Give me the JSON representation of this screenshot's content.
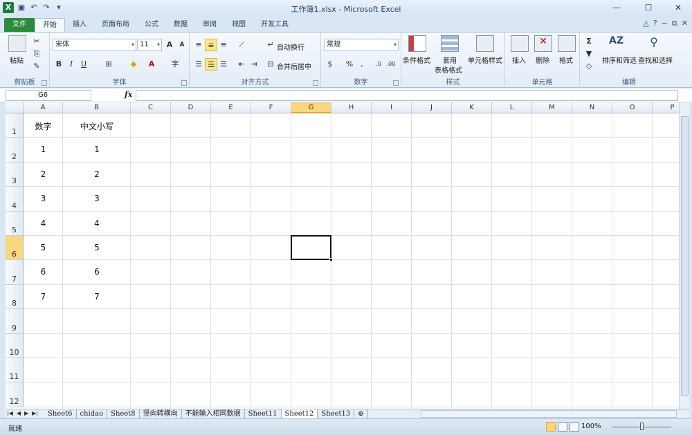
{
  "window": {
    "title": "工作簿1.xlsx - Microsoft Excel",
    "controls": [
      "—",
      "☐",
      "✕"
    ]
  },
  "ribbon_tabs": [
    "文件",
    "开始",
    "插入",
    "页面布局",
    "公式",
    "数据",
    "审阅",
    "视图",
    "开发工具"
  ],
  "active_tab": "开始",
  "groups": {
    "clipboard": {
      "label": "剪贴板",
      "paste": "粘贴"
    },
    "font": {
      "label": "字体",
      "font_name": "宋体",
      "font_size": "11",
      "bold": "B",
      "italic": "I",
      "underline": "U"
    },
    "alignment": {
      "label": "对齐方式",
      "wrap_text": "自动换行",
      "merge_center": "合并后居中"
    },
    "number": {
      "label": "数字",
      "format": "常规",
      "percent": "%",
      "comma": ","
    },
    "styles": {
      "label": "样式",
      "conditional": "条件格式",
      "table": "套用",
      "table2": "表格格式",
      "cell_styles": "单元格样式"
    },
    "cells": {
      "label": "单元格",
      "insert": "插入",
      "delete": "删除",
      "format": "格式"
    },
    "editing": {
      "label": "编辑",
      "sort": "排序和筛选",
      "find": "查找和选择"
    }
  },
  "formula_bar": {
    "name_box": "G6",
    "fx": "fx",
    "formula": ""
  },
  "columns": [
    "A",
    "B",
    "C",
    "D",
    "E",
    "F",
    "G",
    "H",
    "I",
    "J",
    "K",
    "L",
    "M",
    "N",
    "O",
    "P"
  ],
  "selected_column": "G",
  "rows": [
    "1",
    "2",
    "3",
    "4",
    "5",
    "6",
    "7",
    "8",
    "9",
    "10",
    "11",
    "12"
  ],
  "selected_row": "6",
  "cells": {
    "A1": "数字",
    "B1": "中文小写",
    "A2": "1",
    "B2": "1",
    "A3": "2",
    "B3": "2",
    "A4": "3",
    "B4": "3",
    "A5": "4",
    "B5": "4",
    "A6": "5",
    "B6": "5",
    "A7": "6",
    "B7": "6",
    "A8": "7",
    "B8": "7"
  },
  "sheet_tabs": [
    "Sheet6",
    "chidao",
    "Sheet8",
    "竖向转横向",
    "不能输入相同数据",
    "Sheet11",
    "Sheet12",
    "Sheet13"
  ],
  "active_sheet": "Sheet12",
  "status": {
    "ready": "就绪",
    "zoom": "100%"
  }
}
